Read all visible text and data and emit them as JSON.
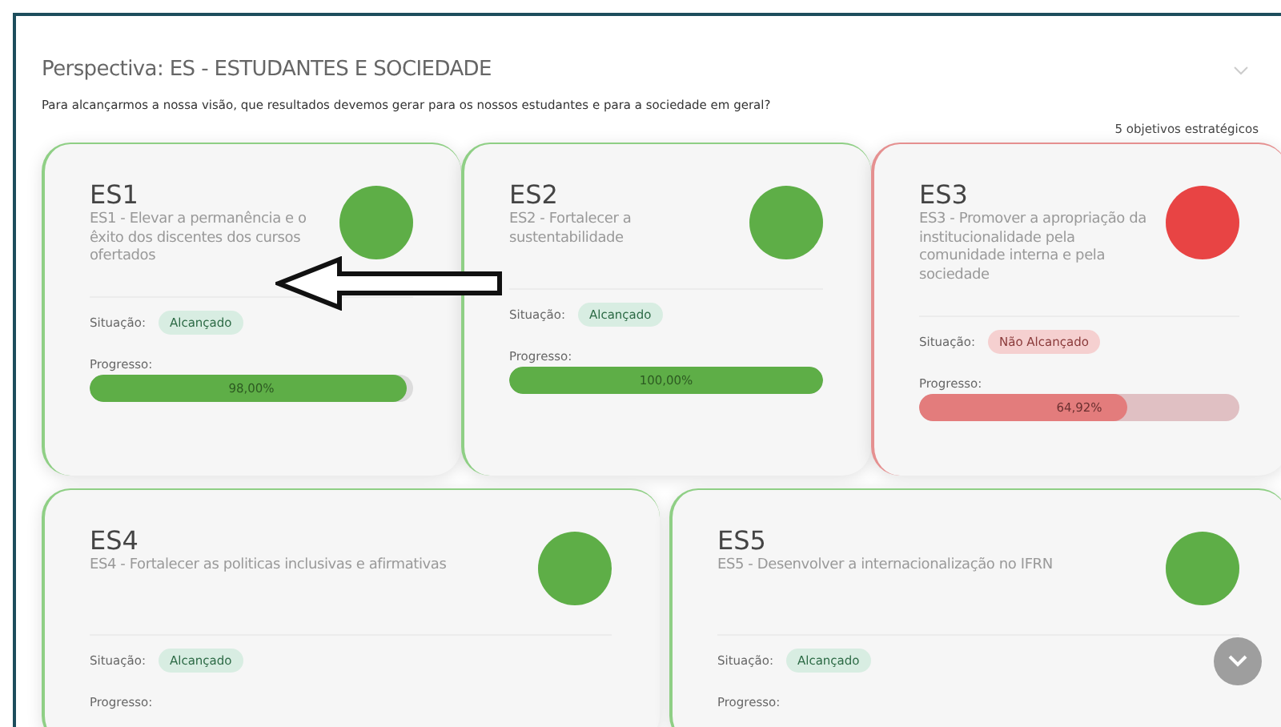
{
  "perspective": {
    "title": "Perspectiva: ES - ESTUDANTES E SOCIEDADE",
    "question": "Para alcançarmos a nossa visão, que resultados devemos gerar para os nossos estudantes e para a sociedade em geral?",
    "count": "5 objetivos estratégicos"
  },
  "cards": [
    {
      "code": "ES1",
      "title": "ES1 - Elevar a permanência e o êxito dos discentes dos cursos ofertados",
      "status_label": "Situação:",
      "status": "Alcançado",
      "achieved": true,
      "progress_label": "Progresso:",
      "progress": {
        "reading": "98,00%",
        "level": 0.98
      }
    },
    {
      "code": "ES2",
      "title": "ES2 - Fortalecer a sustentabilidade",
      "status_label": "Situação:",
      "status": "Alcançado",
      "achieved": true,
      "progress_label": "Progresso:",
      "progress": {
        "reading": "100,00%",
        "level": 1
      }
    },
    {
      "code": "ES3",
      "title": "ES3 - Promover a apropriação da institucionalidade pela comunidade interna e pela sociedade",
      "status_label": "Situação:",
      "status": "Não Alcançado",
      "achieved": false,
      "progress_label": "Progresso:",
      "progress": {
        "reading": "64,92%",
        "level": 0.6492
      }
    },
    {
      "code": "ES4",
      "title": "ES4 - Fortalecer as politicas inclusivas e afirmativas",
      "status_label": "Situação:",
      "status": "Alcançado",
      "achieved": true,
      "progress_label": "Progresso:"
    },
    {
      "code": "ES5",
      "title": "ES5 - Desenvolver a internacionalização no IFRN",
      "status_label": "Situação:",
      "status": "Alcançado",
      "achieved": true,
      "progress_label": "Progresso:"
    }
  ]
}
